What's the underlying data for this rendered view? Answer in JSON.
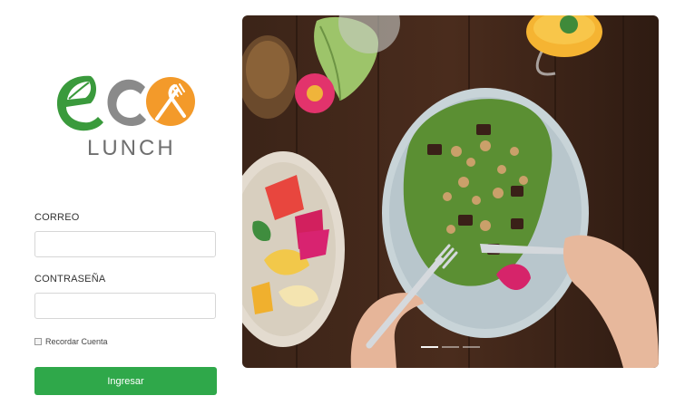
{
  "brand": {
    "logo_letters": [
      "e",
      "c",
      "o"
    ],
    "subtitle": "LUNCH",
    "colors": {
      "green": "#3a9a3c",
      "gray": "#8a8a8a",
      "orange": "#f39a2a"
    }
  },
  "login_form": {
    "email_label": "CORREO",
    "email_value": "",
    "password_label": "CONTRASEÑA",
    "password_value": "",
    "remember_label": "Recordar Cuenta",
    "remember_checked": false,
    "submit_label": "Ingresar",
    "submit_color": "#2fa84a"
  },
  "carousel": {
    "image": "food-photo",
    "slides": 3,
    "active_slide": 1
  }
}
